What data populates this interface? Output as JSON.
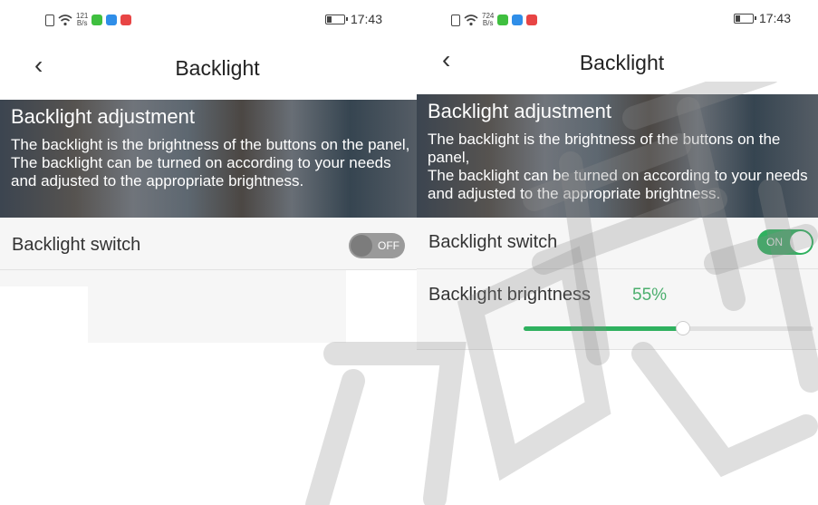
{
  "colors": {
    "accent_green": "#2fb15f",
    "percent_green": "#4caf6e",
    "toggle_off": "#9a9a9a",
    "row_bg": "#f6f6f6"
  },
  "left": {
    "status": {
      "speed_num": "121",
      "speed_unit": "B/s",
      "time": "17:43"
    },
    "header": {
      "back_icon": "‹",
      "title": "Backlight"
    },
    "banner": {
      "title": "Backlight adjustment",
      "line1": "The backlight is the brightness of the buttons on the panel,",
      "line2": "The backlight can be turned on according to your needs and adjusted to the appropriate brightness."
    },
    "switch_row": {
      "label": "Backlight switch",
      "toggle_text": "OFF",
      "state": "off"
    }
  },
  "right": {
    "status": {
      "speed_num": "724",
      "speed_unit": "B/s",
      "time": "17:43"
    },
    "header": {
      "back_icon": "‹",
      "title": "Backlight"
    },
    "banner": {
      "title": "Backlight adjustment",
      "line1": "The backlight is the brightness of the buttons on the panel,",
      "line2": "The backlight can be turned on according to your needs and adjusted to the appropriate brightness."
    },
    "switch_row": {
      "label": "Backlight switch",
      "toggle_text": "ON",
      "state": "on"
    },
    "brightness_row": {
      "label": "Backlight brightness",
      "value_text": "55%",
      "value": 0.55
    }
  }
}
